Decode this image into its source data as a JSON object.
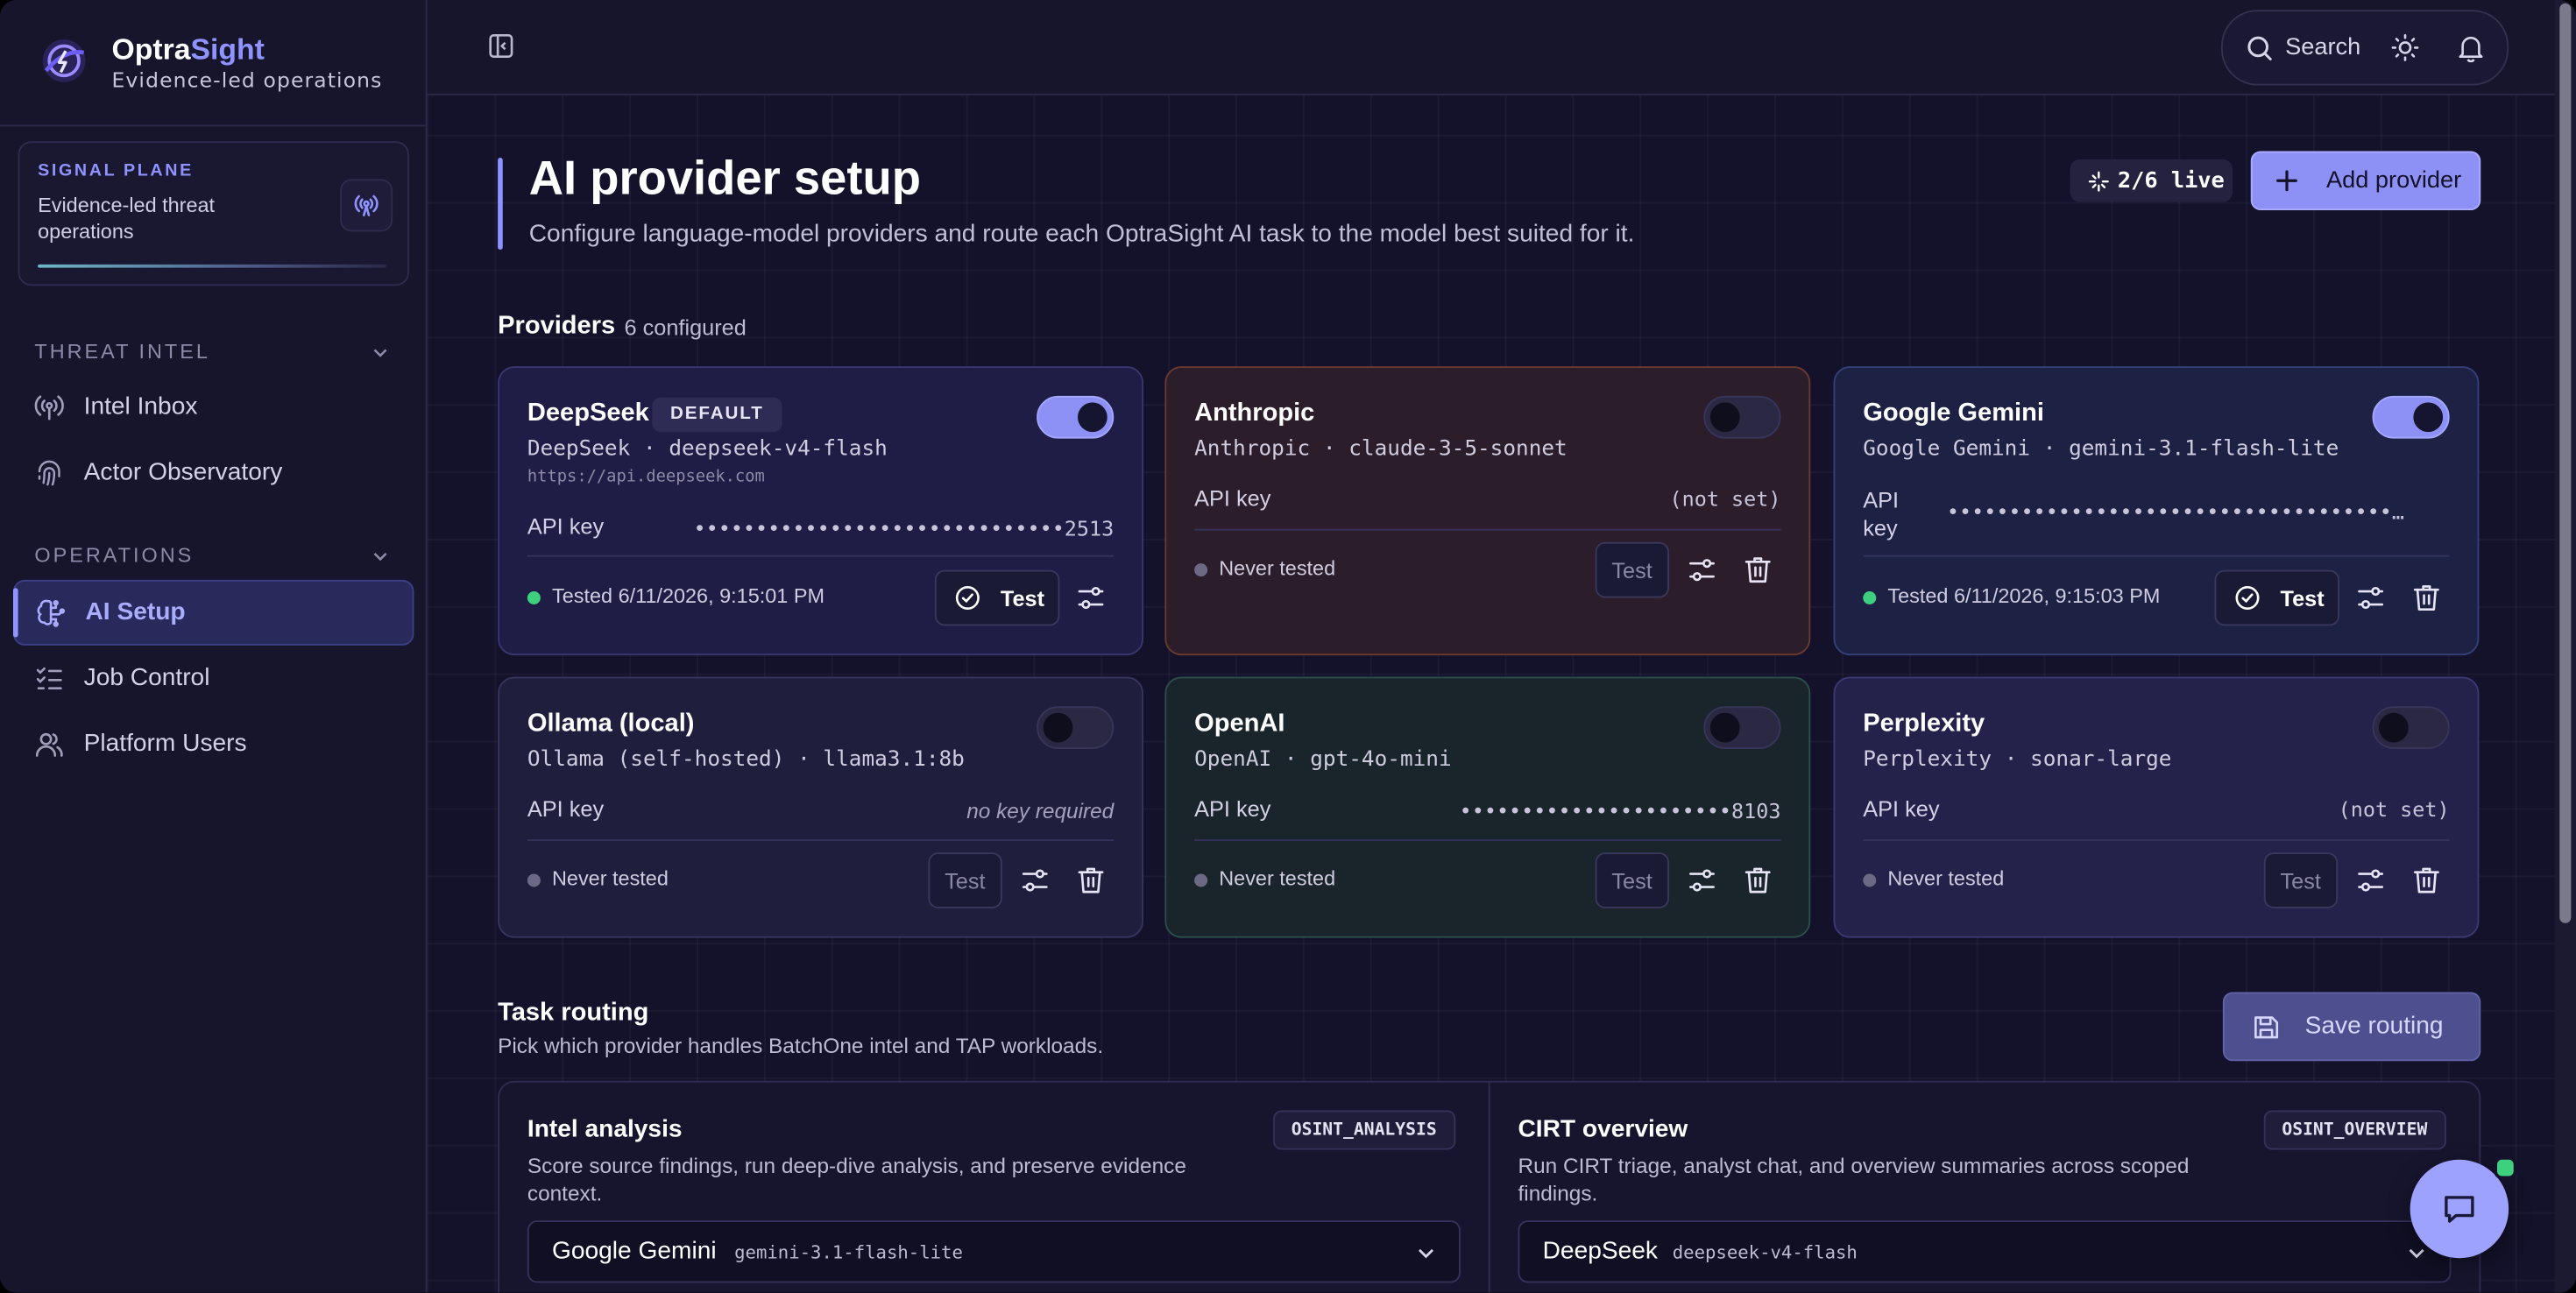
{
  "brand": {
    "name_part1": "Optra",
    "name_part2": "Sight",
    "tagline": "Evidence-led operations",
    "accent_color": "#8f93ff"
  },
  "signal_plane": {
    "label": "SIGNAL PLANE",
    "text": "Evidence-led threat operations",
    "icon": "broadcast-icon"
  },
  "sidebar": {
    "sections": [
      {
        "label": "THREAT INTEL",
        "items": [
          {
            "label": "Intel Inbox",
            "icon": "radio-icon"
          },
          {
            "label": "Actor Observatory",
            "icon": "fingerprint-icon"
          }
        ]
      },
      {
        "label": "OPERATIONS",
        "items": [
          {
            "label": "AI Setup",
            "icon": "brain-icon",
            "active": true
          },
          {
            "label": "Job Control",
            "icon": "checklist-icon"
          },
          {
            "label": "Platform Users",
            "icon": "users-icon"
          }
        ]
      }
    ]
  },
  "topbar": {
    "search_label": "Search",
    "icons": [
      "sidebar-toggle-icon",
      "search-icon",
      "sun-icon",
      "bell-icon"
    ]
  },
  "page": {
    "title": "AI provider setup",
    "subtitle": "Configure language-model providers and route each OptraSight AI task to the model best suited for it.",
    "live_badge": "2/6 live",
    "add_button": "Add provider"
  },
  "providers": {
    "heading": "Providers",
    "count": "6 configured",
    "api_key_label": "API key",
    "test_label": "Test",
    "default_badge": "DEFAULT",
    "cards": [
      {
        "name": "DeepSeek",
        "is_default": true,
        "vendor": "DeepSeek",
        "model": "deepseek-v4-flash",
        "url": "https://api.deepseek.com",
        "enabled": true,
        "api_key": "••••••••••••••••••••••••••••••2513",
        "status": "Tested 6/11/2026, 9:15:01 PM",
        "tested": true
      },
      {
        "name": "Anthropic",
        "is_default": false,
        "vendor": "Anthropic",
        "model": "claude-3-5-sonnet",
        "url": "",
        "enabled": false,
        "api_key": "(not set)",
        "status": "Never tested",
        "tested": false
      },
      {
        "name": "Google Gemini",
        "is_default": false,
        "vendor": "Google Gemini",
        "model": "gemini-3.1-flash-lite",
        "url": "",
        "enabled": true,
        "api_key": "••••••••••••••••••••••••••••••••••••…",
        "status": "Tested 6/11/2026, 9:15:03 PM",
        "tested": true
      },
      {
        "name": "Ollama (local)",
        "is_default": false,
        "vendor": "Ollama (self-hosted)",
        "model": "llama3.1:8b",
        "url": "",
        "enabled": false,
        "api_key": "no key required",
        "status": "Never tested",
        "tested": false
      },
      {
        "name": "OpenAI",
        "is_default": false,
        "vendor": "OpenAI",
        "model": "gpt-4o-mini",
        "url": "",
        "enabled": false,
        "api_key": "••••••••••••••••••••••8103",
        "status": "Never tested",
        "tested": false
      },
      {
        "name": "Perplexity",
        "is_default": false,
        "vendor": "Perplexity",
        "model": "sonar-large",
        "url": "",
        "enabled": false,
        "api_key": "(not set)",
        "status": "Never tested",
        "tested": false
      }
    ]
  },
  "routing": {
    "heading": "Task routing",
    "subtitle": "Pick which provider handles BatchOne intel and TAP workloads.",
    "save_button": "Save routing",
    "tasks": [
      {
        "title": "Intel analysis",
        "code": "OSINT_ANALYSIS",
        "description": "Score source findings, run deep-dive analysis, and preserve evidence context.",
        "provider": "Google Gemini",
        "model": "gemini-3.1-flash-lite"
      },
      {
        "title": "CIRT overview",
        "code": "OSINT_OVERVIEW",
        "description": "Run CIRT triage, analyst chat, and overview summaries across scoped findings.",
        "provider": "DeepSeek",
        "model": "deepseek-v4-flash"
      }
    ]
  }
}
